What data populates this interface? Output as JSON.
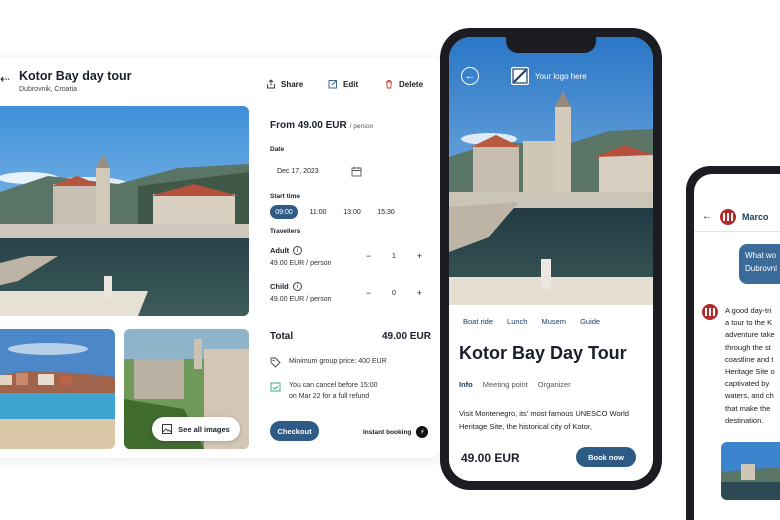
{
  "desktop": {
    "title": "Kotor Bay day tour",
    "location": "Dubrovnik, Croatia",
    "actions": {
      "share": "Share",
      "edit": "Edit",
      "delete": "Delete"
    },
    "price_from": "From 49.00 EUR",
    "price_unit": "/ person",
    "date_label": "Date",
    "date_value": "Dec 17, 2023",
    "start_time_label": "Start time",
    "times": [
      "09:00",
      "11:00",
      "13:00",
      "15:30"
    ],
    "selected_time": "09:00",
    "travellers_label": "Travellers",
    "adult": {
      "label": "Adult",
      "price": "49.00 EUR / person",
      "count": "1"
    },
    "child": {
      "label": "Child",
      "price": "49.00 EUR / person",
      "count": "0"
    },
    "total_label": "Total",
    "total_value": "49.00 EUR",
    "min_group": "Minimum group price: 400 EUR",
    "cancel_line1": "You can cancel before 15:00",
    "cancel_line2": "on Mar 22 for a full refund",
    "checkout": "Checkout",
    "instant_booking": "Instant booking",
    "see_all": "See all images"
  },
  "phone": {
    "logo_text": "Your logo here",
    "chips": [
      "Boat ride",
      "Lunch",
      "Musem",
      "Guide"
    ],
    "title": "Kotor Bay Day Tour",
    "tabs": [
      "Info",
      "Meeting point",
      "Organizer"
    ],
    "active_tab": "Info",
    "description": "Visit Montenegro, its' most famous UNESCO World Heritage Site, the historical city of Kotor,",
    "price": "49.00 EUR",
    "book_now": "Book now"
  },
  "chat": {
    "name": "Marco",
    "outgoing_line1": "What wo",
    "outgoing_line2": "Dubrovni",
    "incoming_lines": [
      "A good day-tri",
      "a tour to the K",
      "adventure take",
      "through the st",
      "coastline and t",
      "Heritage Site o",
      "captivated by",
      "waters, and ch",
      "that make the",
      "destination."
    ]
  },
  "colors": {
    "accent": "#2e5a86",
    "dark": "#1b1d22",
    "link": "#1d3e63"
  },
  "icons": [
    "back-arrow-icon",
    "share-icon",
    "edit-icon",
    "trash-icon",
    "calendar-icon",
    "info-icon",
    "minus-icon",
    "plus-icon",
    "tag-icon",
    "calendar-check-icon",
    "bolt-icon",
    "image-icon",
    "logo-icon",
    "chat-avatar-icon"
  ]
}
